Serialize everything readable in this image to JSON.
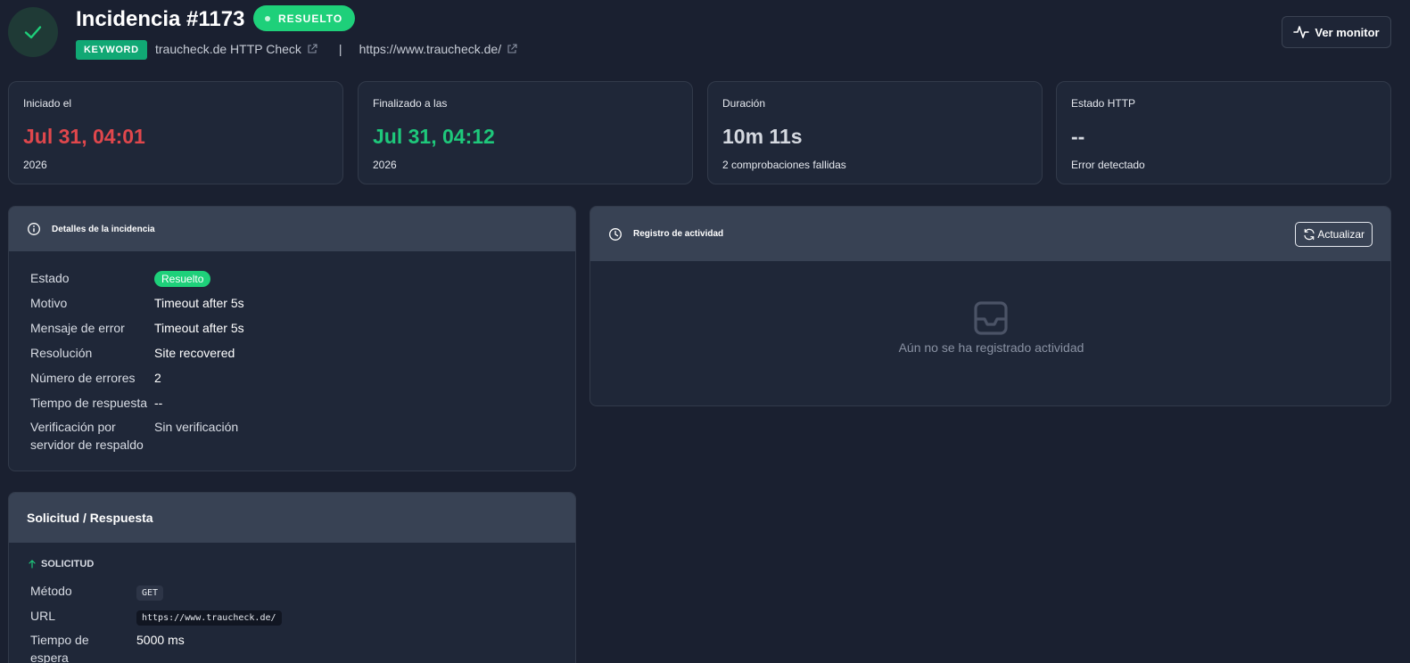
{
  "header": {
    "title": "Incidencia #1173",
    "status_pill": "RESUELTO",
    "keyword_badge": "KEYWORD",
    "monitor_name": "traucheck.de HTTP Check",
    "separator": "|",
    "monitor_url": "https://www.traucheck.de/",
    "view_monitor_label": "Ver monitor"
  },
  "stats": [
    {
      "label": "Iniciado el",
      "value": "Jul 31, 04:01",
      "sub": "2026",
      "color": "#e0474c"
    },
    {
      "label": "Finalizado a las",
      "value": "Jul 31, 04:12",
      "sub": "2026",
      "color": "#1ec87b"
    },
    {
      "label": "Duración",
      "value": "10m 11s",
      "sub": "2 comprobaciones fallidas",
      "color": "#d5d9e0"
    },
    {
      "label": "Estado HTTP",
      "value": "--",
      "sub": "Error detectado",
      "color": "#d5d9e0"
    }
  ],
  "details": {
    "title": "Detalles de la incidencia",
    "rows": [
      {
        "label": "Estado",
        "value": "Resuelto"
      },
      {
        "label": "Motivo",
        "value": "Timeout after 5s"
      },
      {
        "label": "Mensaje de error",
        "value": "Timeout after 5s"
      },
      {
        "label": "Resolución",
        "value": "Site recovered"
      },
      {
        "label": "Número de errores",
        "value": "2"
      },
      {
        "label": "Tiempo de respuesta",
        "value": "--"
      },
      {
        "label": "Verificación por",
        "label2": "servidor de respaldo",
        "value": "Sin verificación"
      }
    ]
  },
  "activity": {
    "title": "Registro de actividad",
    "refresh_label": "Actualizar",
    "empty_text": "Aún no se ha registrado actividad"
  },
  "request": {
    "title": "Solicitud / Respuesta",
    "section_label": "SOLICITUD",
    "rows": [
      {
        "label": "Método",
        "value": "GET"
      },
      {
        "label": "URL",
        "value": "https://www.traucheck.de/"
      },
      {
        "label": "Tiempo de",
        "label2": "espera",
        "value": "5000 ms"
      }
    ]
  },
  "colors": {
    "accent_green": "#1ed07a",
    "error_red": "#e0474c",
    "background": "#1a2030"
  }
}
